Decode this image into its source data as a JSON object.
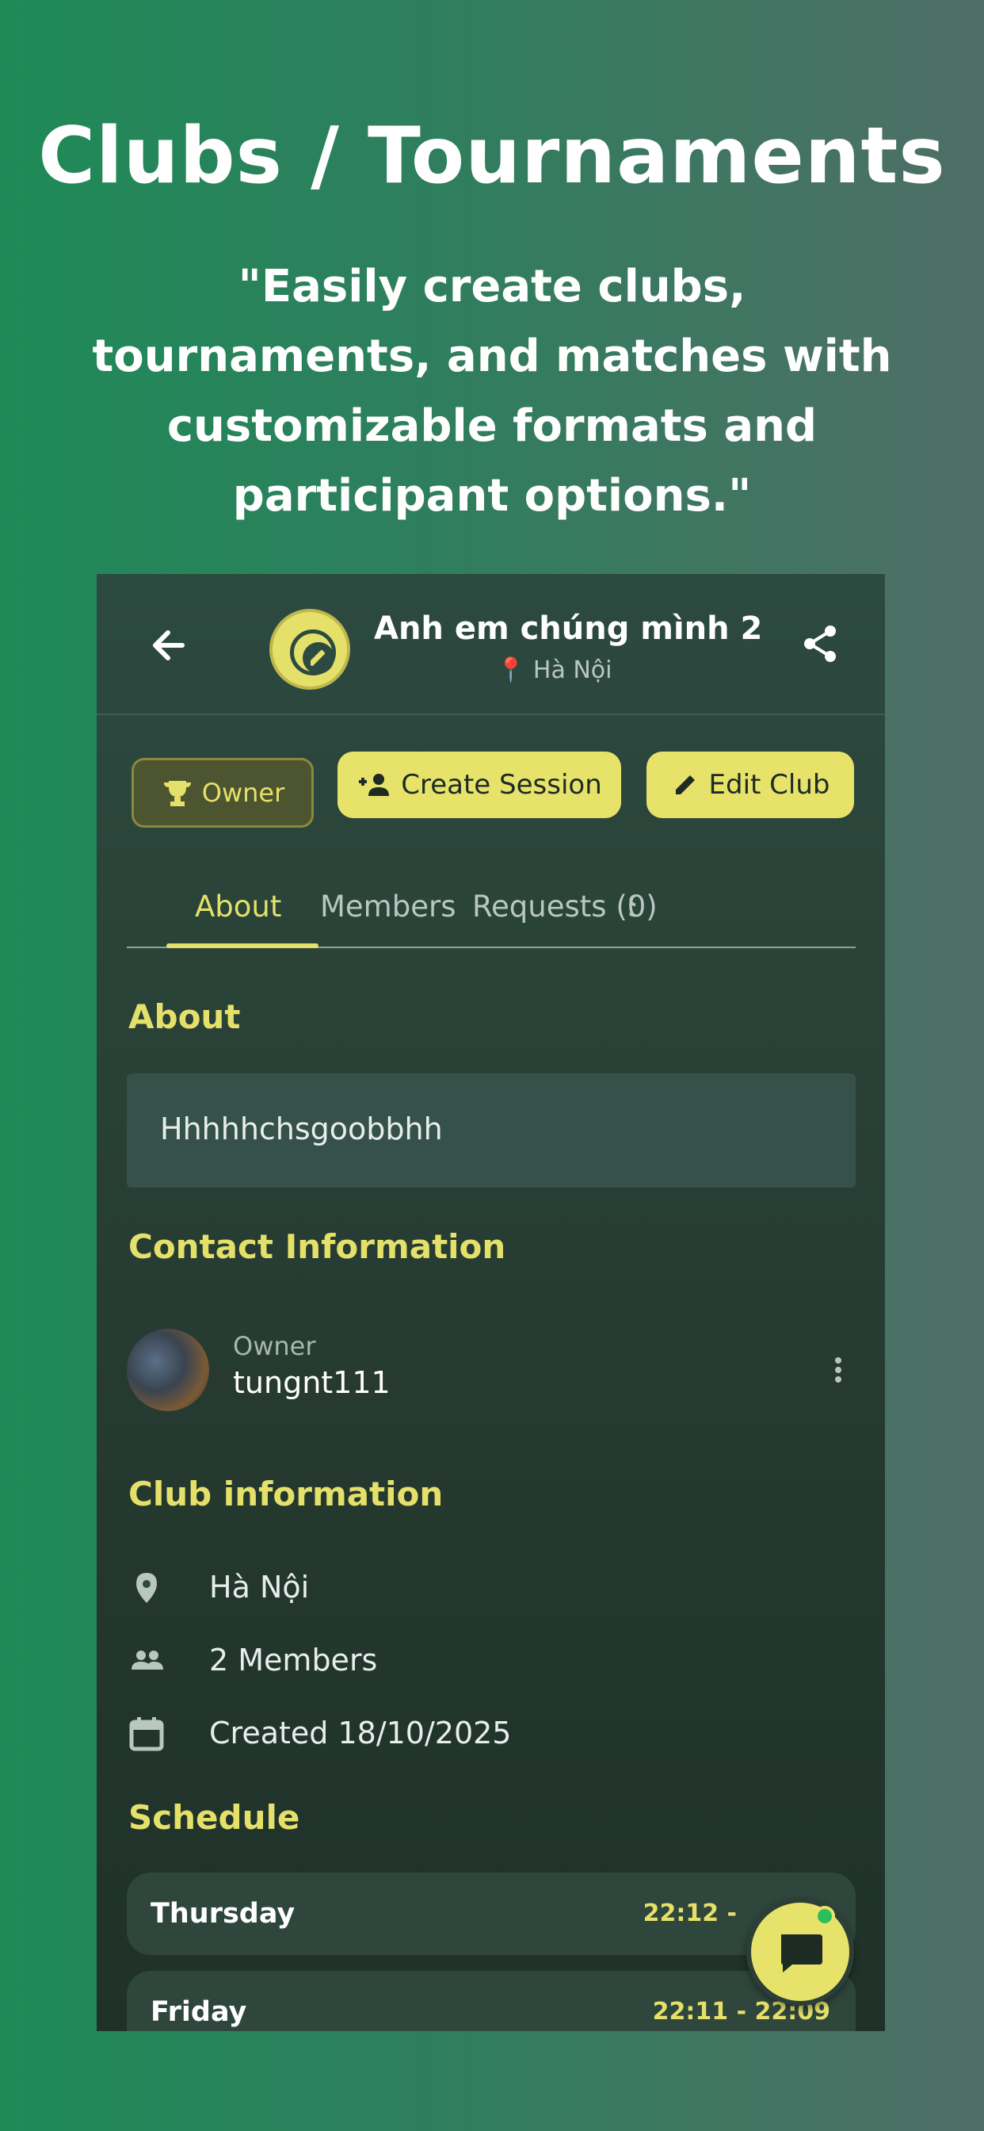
{
  "promo": {
    "title": "Clubs / Tournaments",
    "subtitle": "\"Easily create clubs, tournaments, and matches with customizable formats and participant options.\""
  },
  "header": {
    "club_name": "Anh em chúng mình 2",
    "location": "📍 Hà Nội",
    "back_icon": "arrow-left-icon",
    "share_icon": "share-icon"
  },
  "actions": {
    "owner_label": "Owner",
    "create_session_label": "Create Session",
    "edit_club_label": "Edit Club"
  },
  "tabs": [
    {
      "label": "About",
      "active": true
    },
    {
      "label": "Members",
      "active": false
    },
    {
      "label": "Requests (0)",
      "active": false
    },
    {
      "label": "S",
      "active": false
    }
  ],
  "about": {
    "title": "About",
    "text": "Hhhhhchsgoobbhh"
  },
  "contact": {
    "title": "Contact Information",
    "role": "Owner",
    "name": "tungnt111"
  },
  "club_info": {
    "title": "Club information",
    "location": "Hà Nội",
    "members": "2 Members",
    "created": "Created 18/10/2025"
  },
  "schedule": {
    "title": "Schedule",
    "rows": [
      {
        "day": "Thursday",
        "time": "22:12 -"
      },
      {
        "day": "Friday",
        "time": "22:11 - 22:09"
      }
    ]
  },
  "colors": {
    "accent": "#e5e06a",
    "panel": "#2d4a40",
    "status_online": "#2bbf5c"
  }
}
